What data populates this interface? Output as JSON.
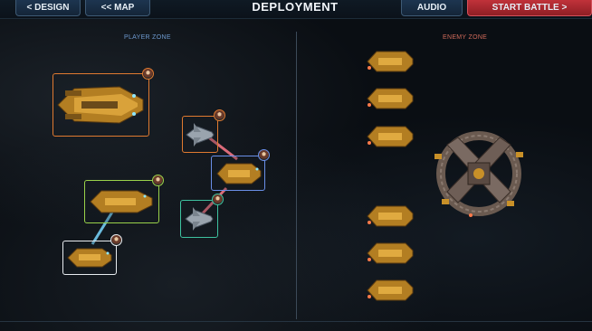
{
  "topbar": {
    "design_label": "< DESIGN",
    "map_label": "<< MAP",
    "title": "DEPLOYMENT",
    "audio_label": "AUDIO",
    "start_label": "START BATTLE >"
  },
  "zones": {
    "player_label": "PLAYER ZONE",
    "enemy_label": "ENEMY ZONE"
  },
  "colors": {
    "box_orange": "#e07a30",
    "box_blue": "#6a8fe8",
    "box_green": "#9ad24a",
    "box_teal": "#3ec2a0",
    "box_white": "#e8ecf0",
    "link_red": "#ff7a8a",
    "link_cyan": "#7ad8ff",
    "hull_gold": "#c89028",
    "start_red": "#c0323a"
  },
  "player_units": [
    {
      "name": "capital-ship",
      "box_color": "orange"
    },
    {
      "name": "fighter-1",
      "box_color": "orange"
    },
    {
      "name": "cruiser-blue",
      "box_color": "blue"
    },
    {
      "name": "frigate-green",
      "box_color": "green"
    },
    {
      "name": "fighter-2",
      "box_color": "teal"
    },
    {
      "name": "frigate-white",
      "box_color": "white"
    }
  ],
  "enemy_units": [
    {
      "name": "enemy-frigate"
    },
    {
      "name": "enemy-frigate"
    },
    {
      "name": "enemy-frigate"
    },
    {
      "name": "enemy-frigate"
    },
    {
      "name": "enemy-frigate"
    },
    {
      "name": "enemy-frigate"
    },
    {
      "name": "enemy-station"
    }
  ]
}
